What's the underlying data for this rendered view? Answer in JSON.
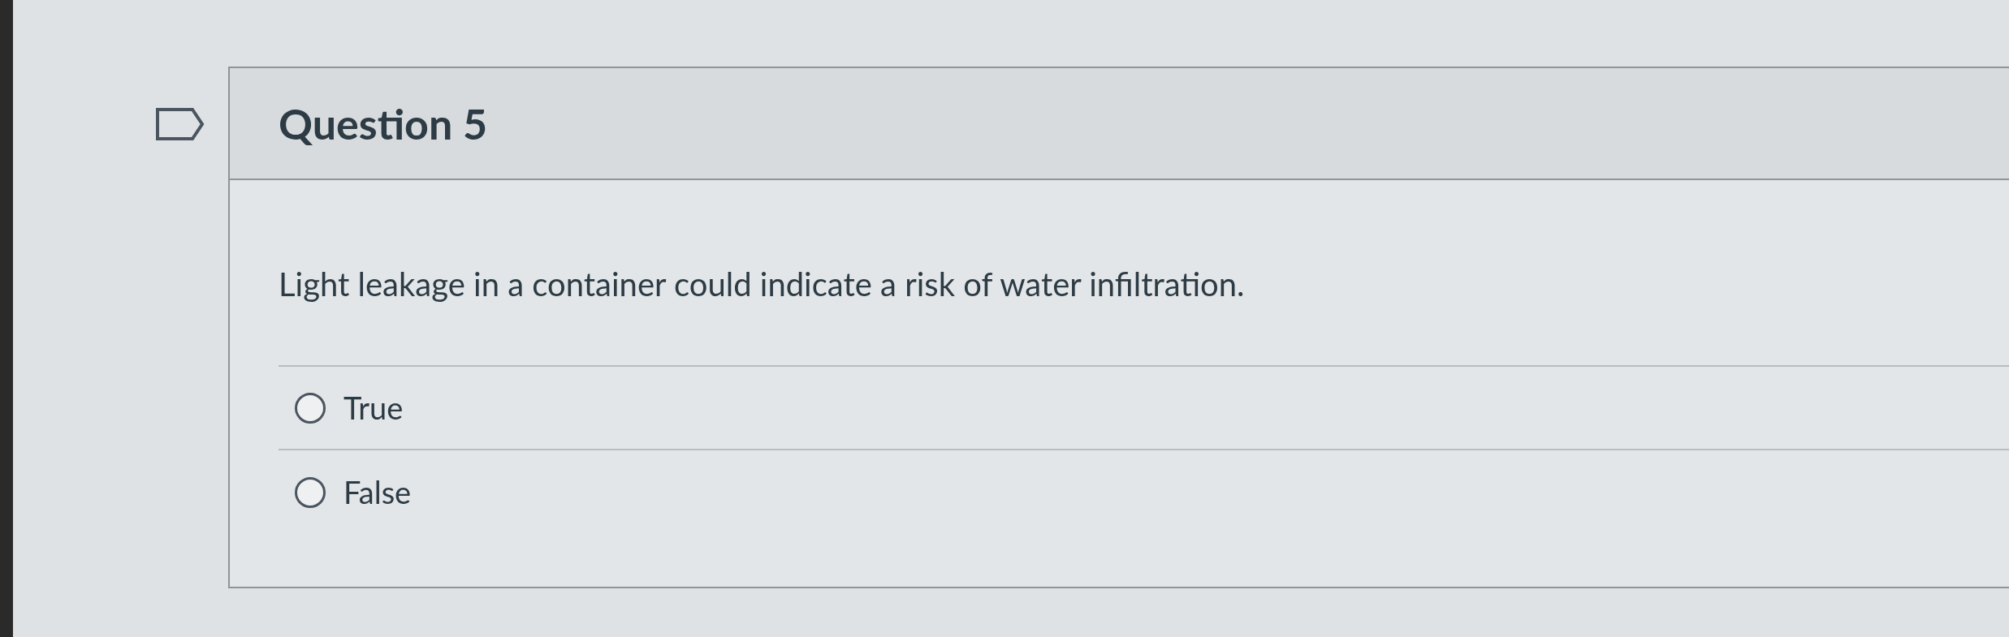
{
  "question": {
    "title": "Question 5",
    "flagged": false,
    "text": "Light leakage in a container could indicate a risk of water infiltration.",
    "answers": [
      {
        "label": "True",
        "selected": false
      },
      {
        "label": "False",
        "selected": false
      }
    ]
  }
}
